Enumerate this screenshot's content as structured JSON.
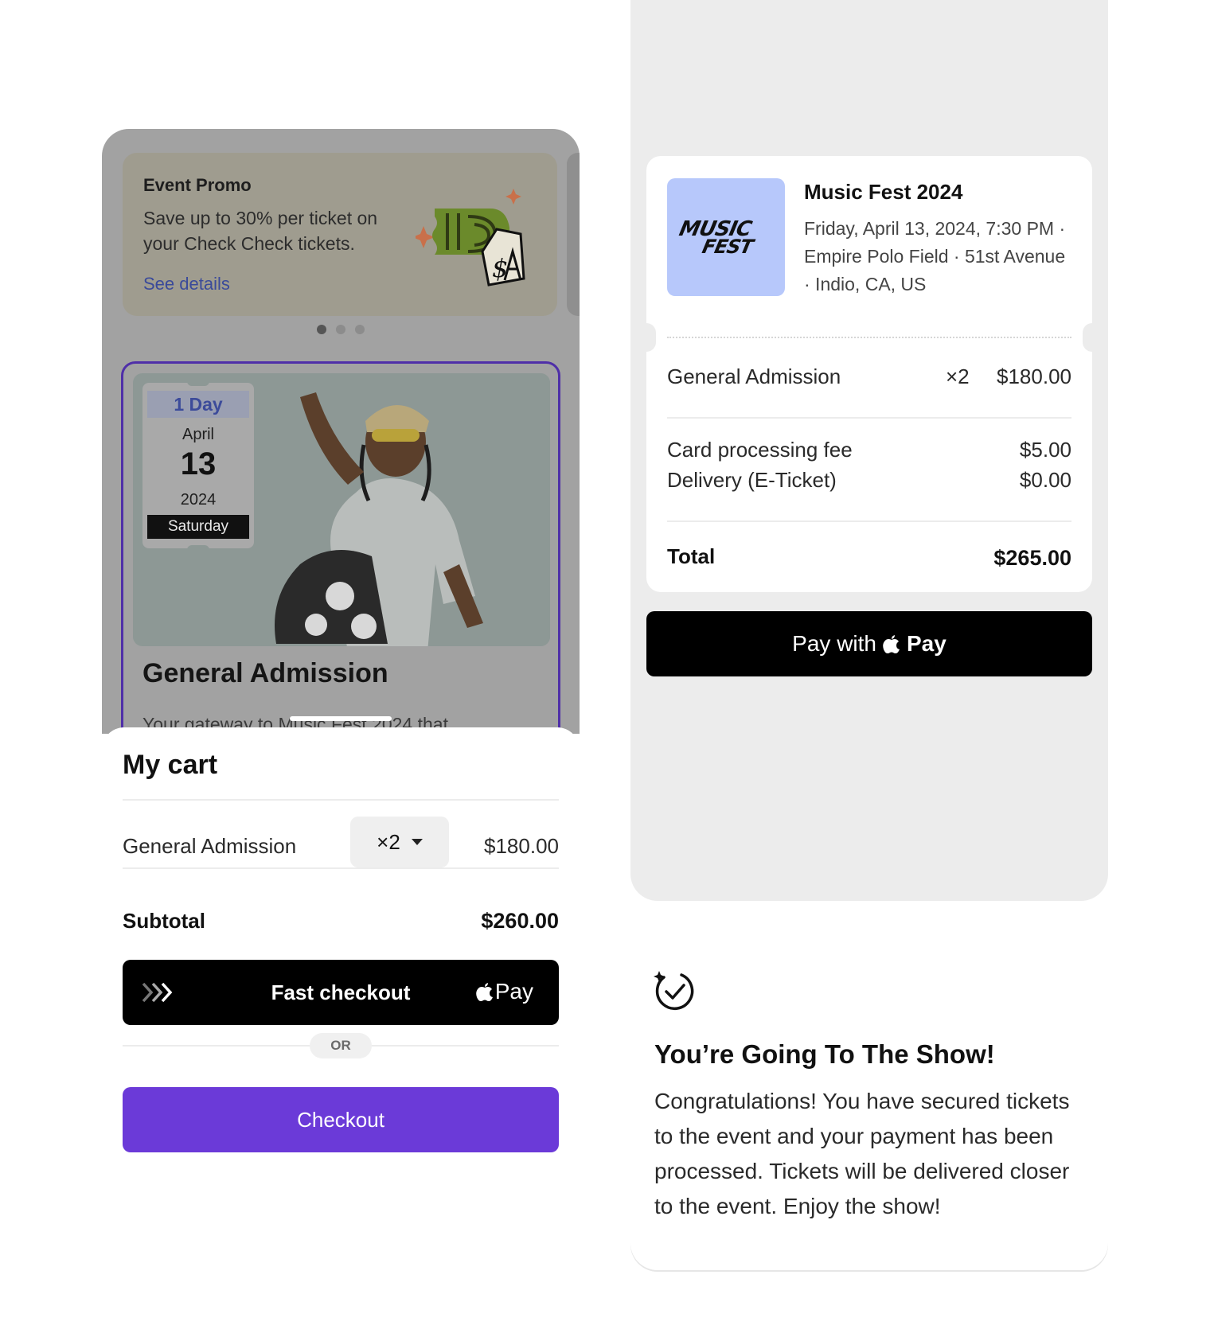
{
  "promo": {
    "title": "Event Promo",
    "text": "Save up to 30% per ticket on your Check Check tickets.",
    "link": "See details",
    "illustration_icon": "ticket-dollar-illustration"
  },
  "carousel": {
    "count": 3,
    "active_index": 0
  },
  "ticket": {
    "date_tag": {
      "duration": "1 Day",
      "month": "April",
      "day": "13",
      "year": "2024",
      "weekday": "Saturday"
    },
    "heading": "General Admission",
    "description": "Your gateway to Music Fest 2024 that"
  },
  "cart": {
    "title": "My cart",
    "item": {
      "label": "General Admission",
      "quantity": "×2",
      "price": "$180.00"
    },
    "subtotal_label": "Subtotal",
    "subtotal_value": "$260.00",
    "fast_checkout_label": "Fast checkout",
    "fast_checkout_pay": "Pay",
    "or_label": "OR",
    "checkout_label": "Checkout"
  },
  "order_summary": {
    "event_title": "Music Fest 2024",
    "event_meta": "Friday, April 13, 2024, 7:30 PM · Empire Polo Field · 51st Avenue · Indio, CA, US",
    "thumb_logo": "MUSIC FEST",
    "line_items": [
      {
        "label": "General Admission",
        "qty": "×2",
        "value": "$180.00"
      },
      {
        "label": "Card processing fee",
        "value": "$5.00"
      },
      {
        "label": "Delivery (E-Ticket)",
        "value": "$0.00"
      }
    ],
    "total_label": "Total",
    "total_value": "$265.00",
    "pay_button_prefix": "Pay with",
    "pay_button_word": "Pay"
  },
  "confirmation": {
    "icon": "check-circle-sparkle-icon",
    "title": "You’re Going To The Show!",
    "body": "Congratulations! You have secured tickets to the event and your payment has been processed. Tickets will be delivered closer to the event. Enjoy the show!"
  },
  "colors": {
    "accent": "#6b3ad8",
    "thumb_bg": "#b7c8fb",
    "overlay": "#a2a2a2",
    "panel_bg": "#ececec"
  }
}
